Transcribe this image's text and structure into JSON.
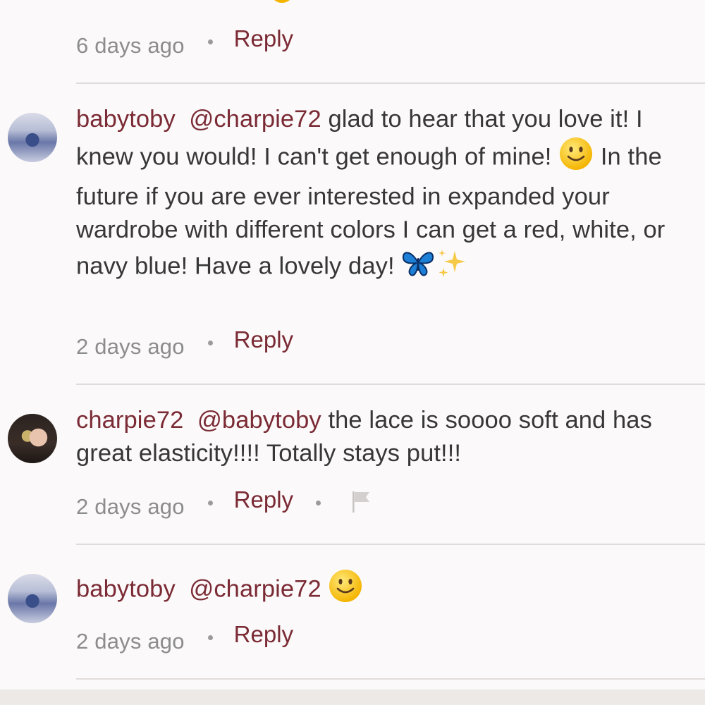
{
  "comments": [
    {
      "time": "6 days ago",
      "reply": "Reply"
    },
    {
      "username": "babytoby",
      "mention": "@charpie72",
      "text1": " glad to hear that you love it! I knew you would! I can't get enough of mine! ",
      "text2": " In the future if you are ever interested in expanded your wardrobe with different colors I can get a red, white, or navy blue! Have a lovely day! ",
      "time": "2 days ago",
      "reply": "Reply"
    },
    {
      "username": "charpie72",
      "mention": "@babytoby",
      "text": " the lace is soooo soft and has great elasticity!!!!  Totally stays put!!!",
      "time": "2 days ago",
      "reply": "Reply"
    },
    {
      "username": "babytoby",
      "mention": "@charpie72",
      "time": "2 days ago",
      "reply": "Reply"
    }
  ],
  "icons": {
    "smiley": "slightly-smiling-face-icon",
    "butterfly": "butterfly-icon",
    "sparkles": "sparkles-icon",
    "flag": "flag-icon"
  },
  "colors": {
    "accent": "#7b2b35",
    "text": "#373737",
    "meta": "#8c8c8c",
    "divider": "#e1dcdc",
    "background": "#fbf9f9"
  }
}
